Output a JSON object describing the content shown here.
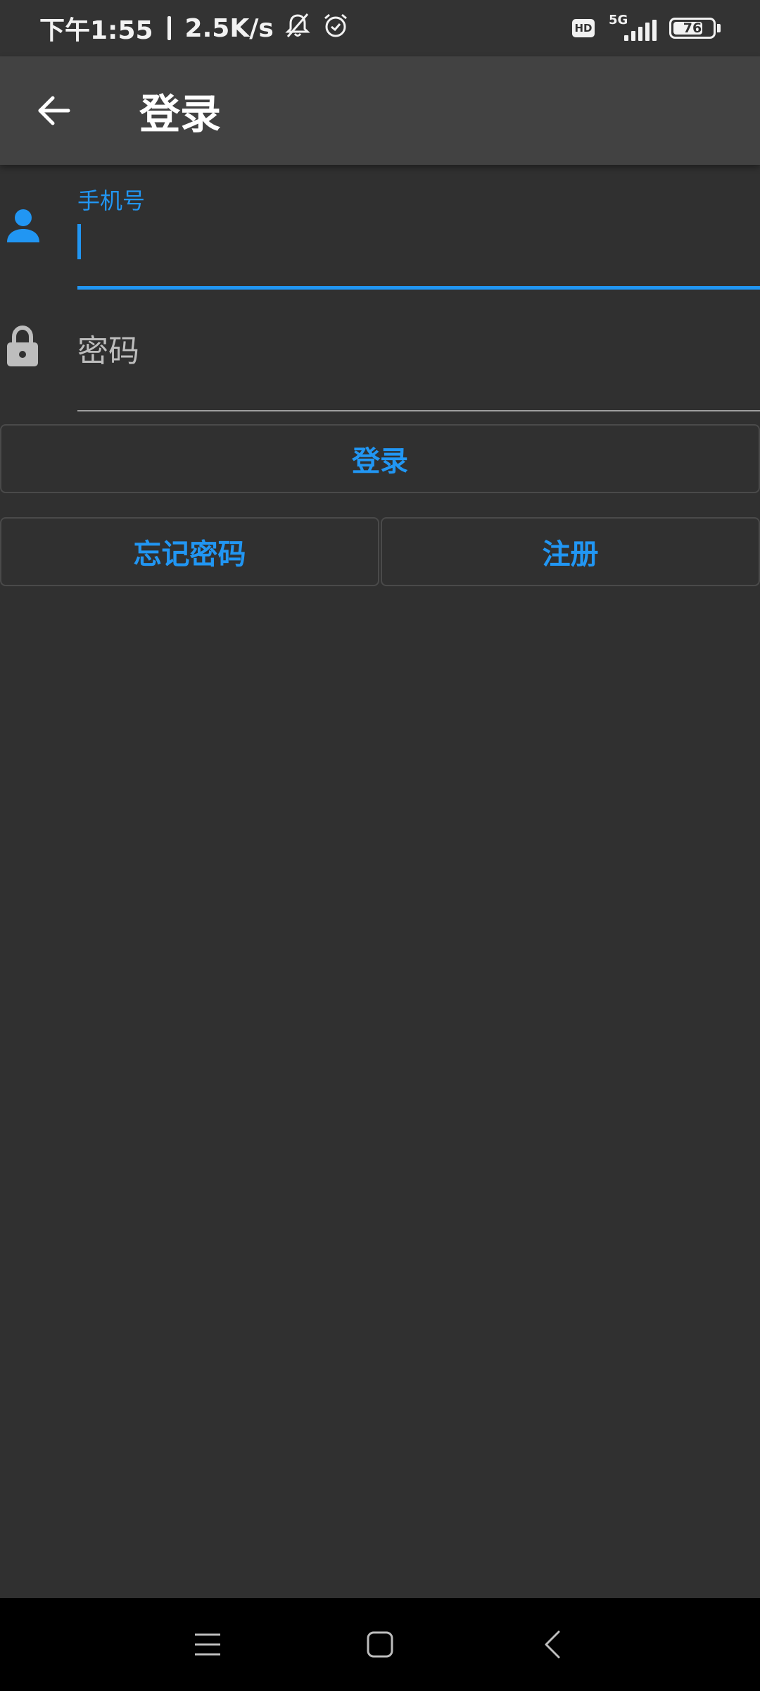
{
  "status_bar": {
    "time": "下午1:55",
    "net_speed": "2.5K/s",
    "hd_label": "HD",
    "network_label": "5G",
    "battery_level": "76",
    "battery_fraction": 0.76
  },
  "app_bar": {
    "title": "登录"
  },
  "form": {
    "phone": {
      "label": "手机号",
      "value": ""
    },
    "password": {
      "placeholder": "密码",
      "value": ""
    }
  },
  "buttons": {
    "login": "登录",
    "forgot_password": "忘记密码",
    "register": "注册"
  },
  "colors": {
    "accent": "#2196f3",
    "background": "#303030",
    "app_bar": "#424242",
    "nav_bar": "#000000"
  },
  "icons": {
    "back": "arrow-left-icon",
    "phone_field": "person-icon",
    "password_field": "lock-icon",
    "nav_menu": "menu-icon",
    "nav_home": "home-icon",
    "nav_back": "chevron-left-icon"
  }
}
